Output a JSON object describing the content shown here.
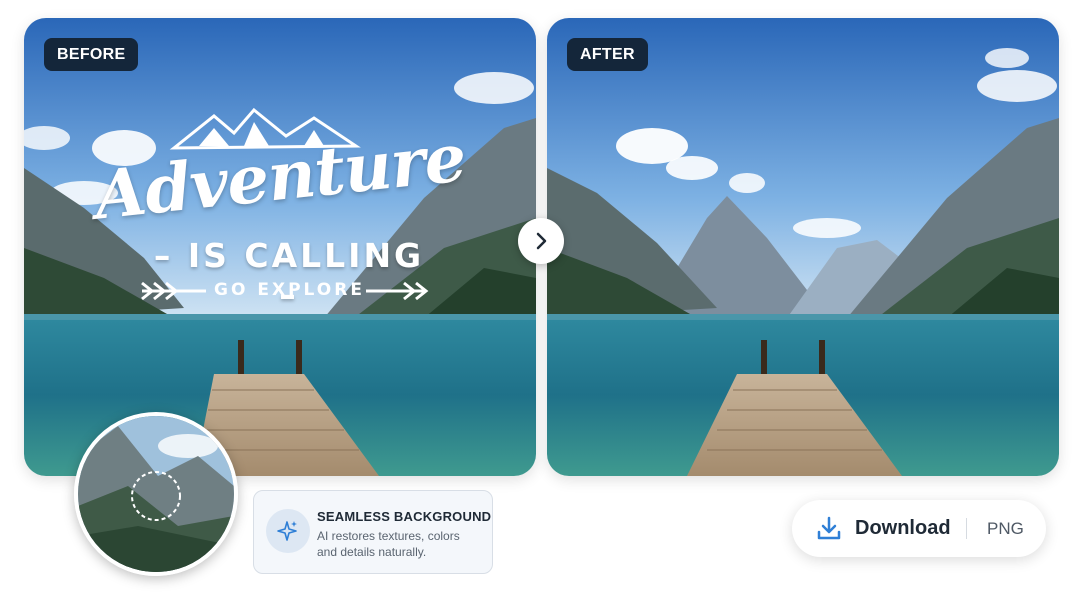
{
  "before": {
    "label": "BEFORE",
    "overlay": {
      "title": "Adventure",
      "subtitle": "– IS CALLING –",
      "tagline": "GO EXPLORE"
    }
  },
  "after": {
    "label": "AFTER"
  },
  "comparison": {
    "divider_icon": "chevron-right-icon"
  },
  "callout": {
    "icon": "sparkle-icon",
    "title": "SEAMLESS BACKGROUND",
    "description": "AI restores textures, colors and details naturally."
  },
  "download": {
    "icon": "download-icon",
    "label": "Download",
    "format": "PNG"
  },
  "colors": {
    "badge_bg": "#14263a",
    "accent": "#2f7fd6",
    "sky_top": "#2a6fbf",
    "water": "#1f7e92"
  }
}
